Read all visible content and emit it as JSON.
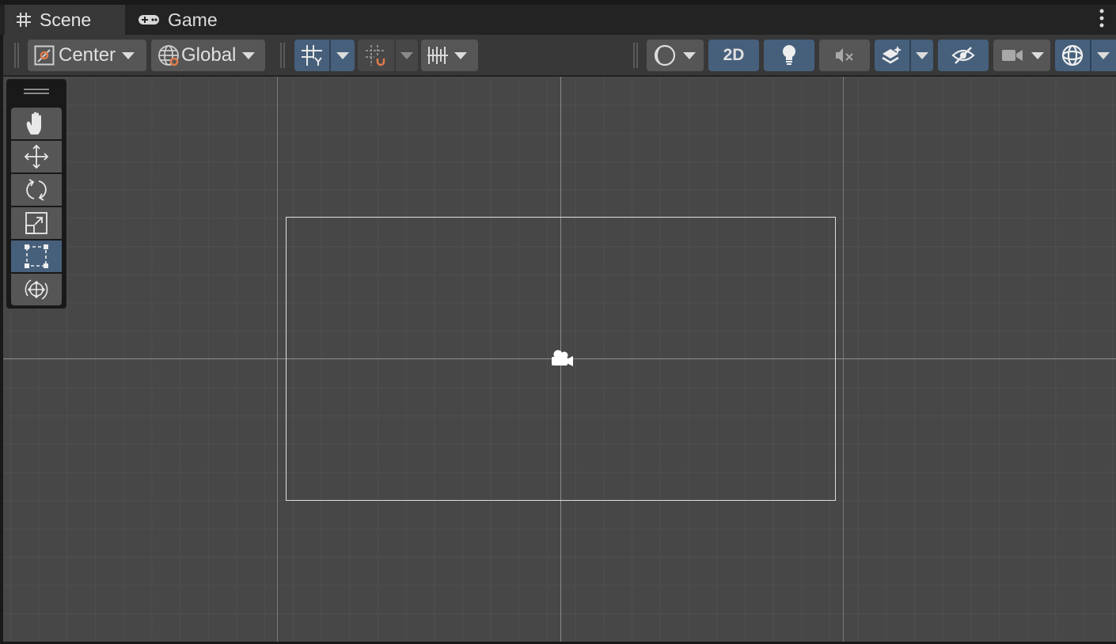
{
  "tabs": [
    {
      "label": "Scene",
      "icon": "hash-icon",
      "active": true
    },
    {
      "label": "Game",
      "icon": "gamepad-icon",
      "active": false
    }
  ],
  "toolbar": {
    "pivot_mode": "Center",
    "pivot_rotation": "Global",
    "mode_2d_label": "2D"
  },
  "tools": [
    {
      "name": "hand-tool",
      "icon": "hand-icon",
      "selected": false
    },
    {
      "name": "move-tool",
      "icon": "move-arrows-icon",
      "selected": false
    },
    {
      "name": "rotate-tool",
      "icon": "rotate-icon",
      "selected": false
    },
    {
      "name": "scale-tool",
      "icon": "scale-icon",
      "selected": false
    },
    {
      "name": "rect-tool",
      "icon": "rect-transform-icon",
      "selected": true
    },
    {
      "name": "transform-tool",
      "icon": "transform-icon",
      "selected": false
    }
  ],
  "colors": {
    "accent_blue": "#46607c",
    "panel": "#383838",
    "scene_bg": "#474747",
    "snap_orange": "#e07b4c"
  }
}
